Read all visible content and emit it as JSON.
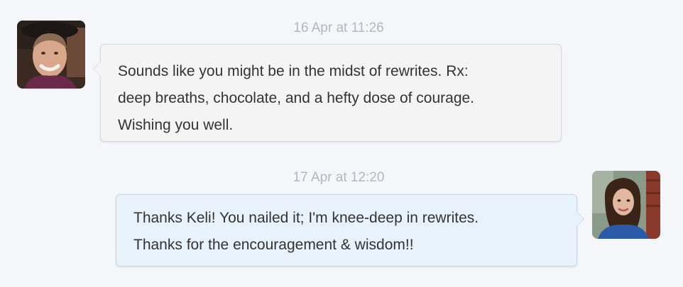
{
  "thread": {
    "messages": [
      {
        "timestamp": "16 Apr at 11:26",
        "direction": "incoming",
        "avatar": "avatar-photo-woman-dark-hat",
        "lines": [
          "Sounds like you might be in the midst of rewrites. Rx:",
          "deep breaths, chocolate, and a hefty dose of courage.",
          "Wishing you well."
        ]
      },
      {
        "timestamp": "17 Apr at 12:20",
        "direction": "outgoing",
        "avatar": "avatar-photo-woman-long-hair",
        "lines": [
          "Thanks Keli! You nailed it; I'm knee-deep in rewrites.",
          "Thanks for the encouragement & wisdom!!"
        ]
      }
    ]
  },
  "colors": {
    "background": "#f4f6f9",
    "incoming_bubble": "#f4f4f4",
    "outgoing_bubble": "#e8f2fb",
    "timestamp_text": "#b3b8bf",
    "message_text": "#333333"
  }
}
